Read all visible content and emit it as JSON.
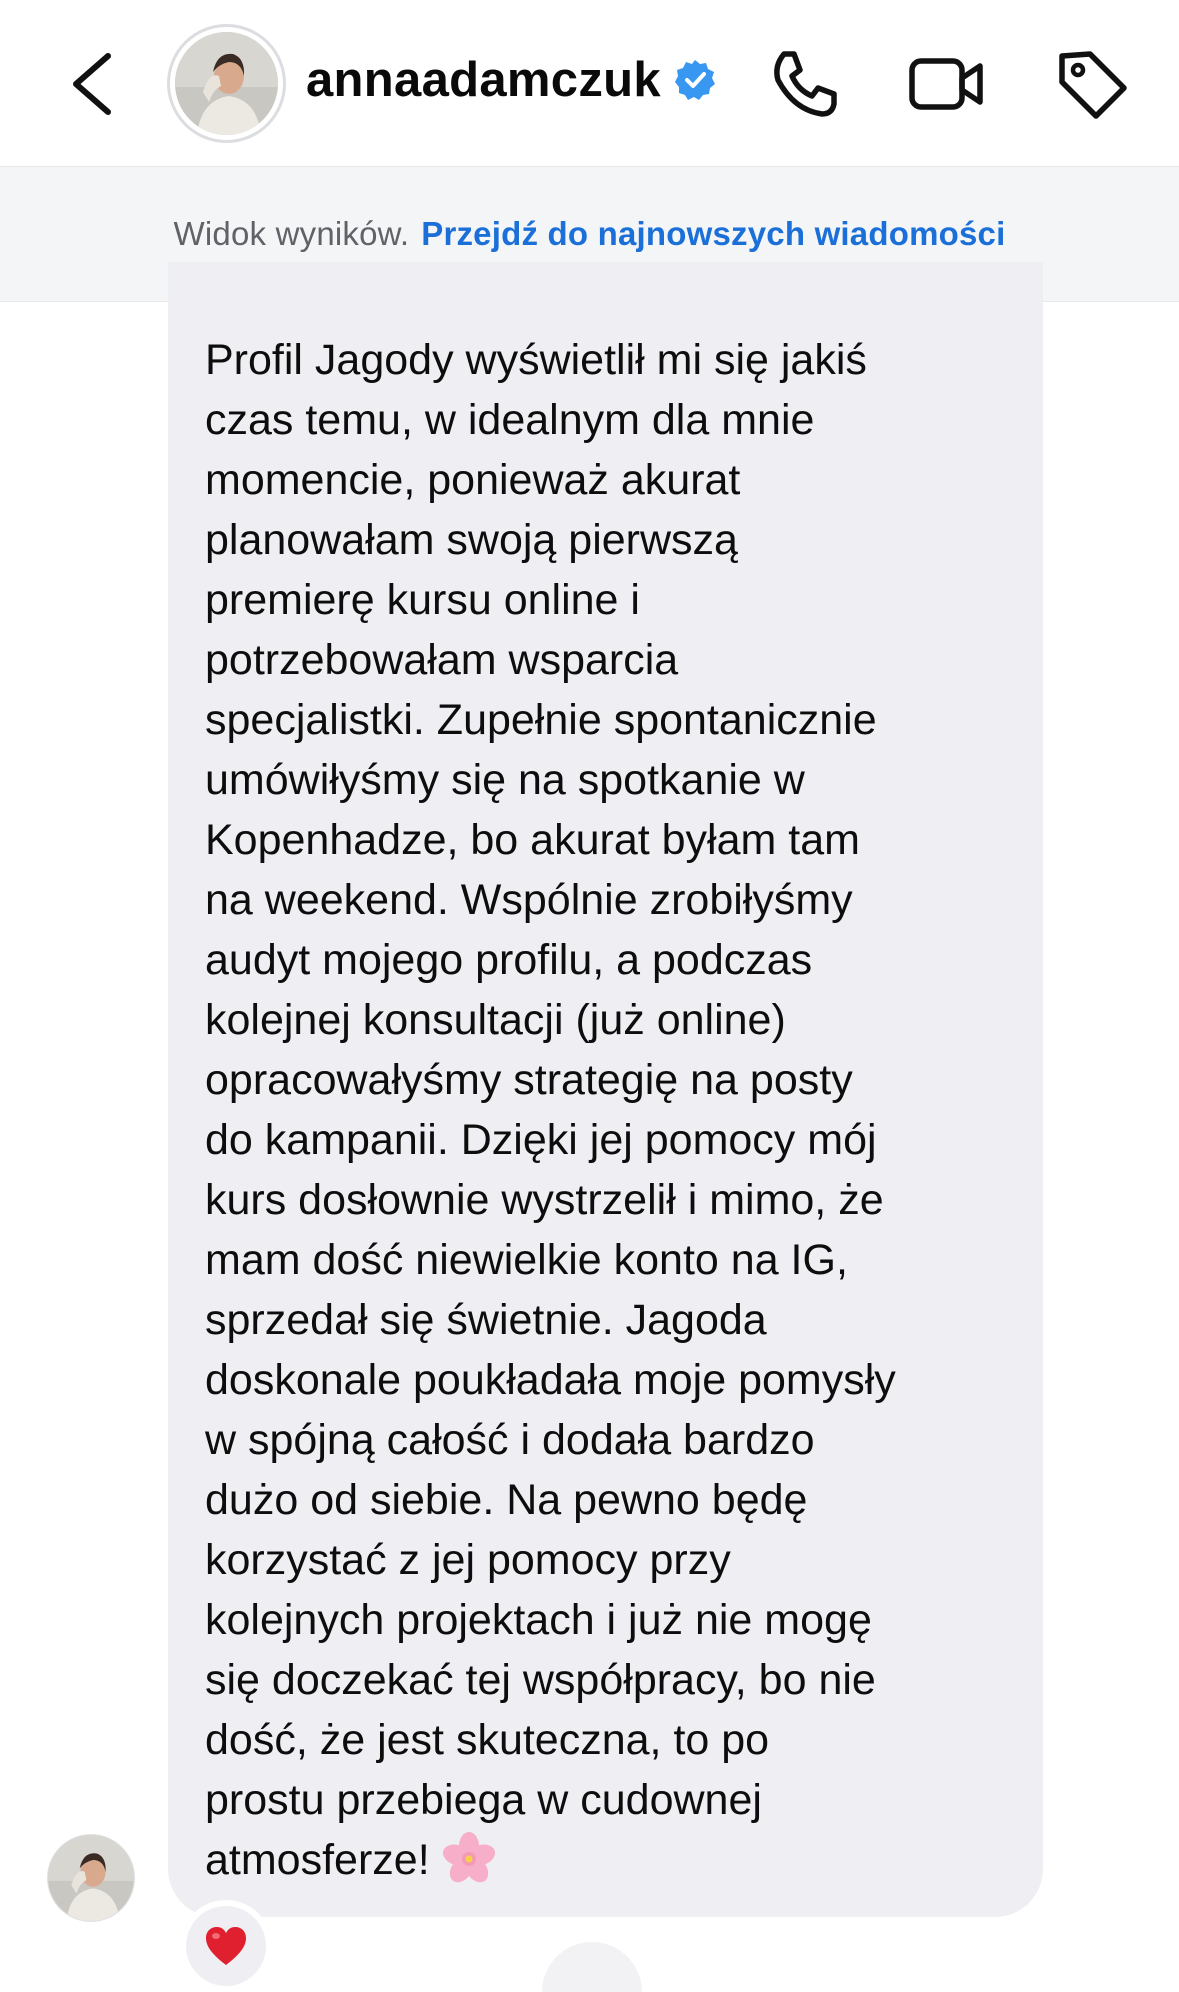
{
  "header": {
    "back_icon": "chevron-left-icon",
    "username": "annaadamczuk",
    "verified_icon": "verified-badge-icon",
    "call_icon": "phone-icon",
    "video_icon": "video-camera-icon",
    "tag_icon": "tag-icon"
  },
  "banner": {
    "text": "Widok wyników.",
    "link": "Przejdź do najnowszych wiadomości"
  },
  "message": {
    "text": "Profil Jagody wyświetlił mi się jakiś\nczas temu, w idealnym dla mnie\nmomencie, ponieważ akurat\nplanowałam swoją pierwszą\npremierę kursu online i\npotrzebowałam wsparcia\nspecjalistki. Zupełnie spontanicznie\numówiłyśmy się na spotkanie w\nKopenhadze, bo akurat byłam tam\nna weekend. Wspólnie zrobiłyśmy\naudyt mojego profilu, a podczas\nkolejnej konsultacji (już online)\nopracowałyśmy strategię na posty\ndo kampanii. Dzięki jej pomocy mój\nkurs dosłownie wystrzelił i mimo, że\nmam dość niewielkie konto na IG,\nsprzedał się świetnie. Jagoda\ndoskonale poukładała moje pomysły\nw spójną całość i dodała bardzo\ndużo od siebie. Na pewno będę\nkorzystać z jej pomocy przy\nkolejnych projektach i już nie mogę\nsię doczekać tej współpracy, bo nie\ndość, że jest skuteczna, to po\nprostu przebiega w cudownej\natmosferze!",
    "emoji_icon": "cherry-blossom-icon",
    "reaction_icon": "red-heart-icon"
  },
  "colors": {
    "accent": "#1b6fd8",
    "bubble": "#efeff3",
    "banner_bg": "#f4f5f6",
    "heart": "#e0202e",
    "verified": "#3897f0"
  }
}
